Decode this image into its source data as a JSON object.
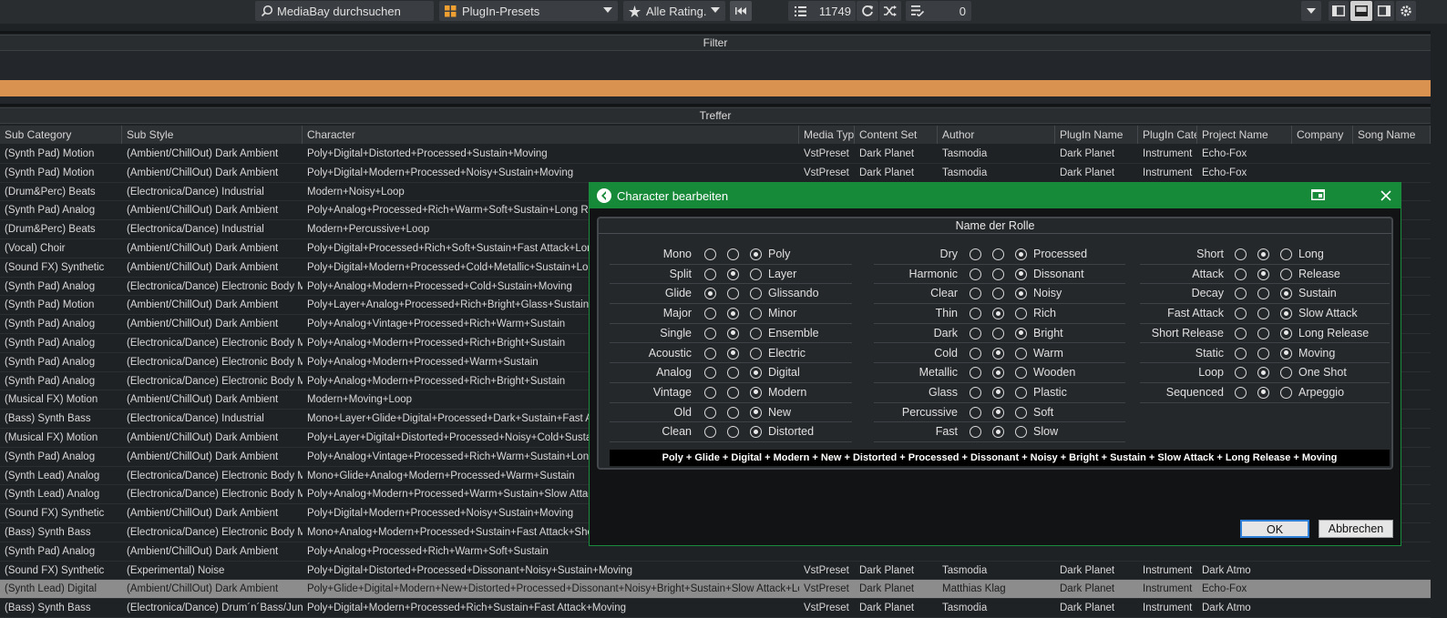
{
  "toolbar": {
    "search_placeholder": "MediaBay durchsuchen",
    "preset_select": "PlugIn-Presets",
    "rating_select": "Alle Rating.",
    "result_count": "11749",
    "selected_count": "0"
  },
  "filter": {
    "title": "Filter"
  },
  "results": {
    "title": "Treffer",
    "columns": [
      "Sub Category",
      "Sub Style",
      "Character",
      "Media Type",
      "Content Set",
      "Author",
      "PlugIn Name",
      "PlugIn Cate",
      "Project Name",
      "Company",
      "Song Name"
    ],
    "rows": [
      [
        "(Synth Pad) Motion",
        "(Ambient/ChillOut) Dark Ambient",
        "Poly+Digital+Distorted+Processed+Sustain+Moving",
        "VstPreset",
        "Dark Planet",
        "Tasmodia",
        "Dark Planet",
        "Instrument",
        "Echo-Fox",
        "",
        ""
      ],
      [
        "(Synth Pad) Motion",
        "(Ambient/ChillOut) Dark Ambient",
        "Poly+Digital+Modern+Processed+Noisy+Sustain+Moving",
        "VstPreset",
        "Dark Planet",
        "Tasmodia",
        "Dark Planet",
        "Instrument",
        "Echo-Fox",
        "",
        ""
      ],
      [
        "(Drum&Perc) Beats",
        "(Electronica/Dance) Industrial",
        "Modern+Noisy+Loop",
        "",
        "",
        "",
        "",
        "",
        "",
        "",
        ""
      ],
      [
        "(Synth Pad) Analog",
        "(Ambient/ChillOut) Dark Ambient",
        "Poly+Analog+Processed+Rich+Warm+Soft+Sustain+Long Releas",
        "",
        "",
        "",
        "",
        "",
        "",
        "",
        ""
      ],
      [
        "(Drum&Perc) Beats",
        "(Electronica/Dance) Industrial",
        "Modern+Percussive+Loop",
        "",
        "",
        "",
        "",
        "",
        "",
        "",
        ""
      ],
      [
        "(Vocal) Choir",
        "(Ambient/ChillOut) Dark Ambient",
        "Poly+Digital+Processed+Rich+Soft+Sustain+Fast Attack+Long R",
        "",
        "",
        "",
        "",
        "",
        "",
        "",
        ""
      ],
      [
        "(Sound FX) Synthetic",
        "(Ambient/ChillOut) Dark Ambient",
        "Poly+Digital+Modern+Processed+Cold+Metallic+Sustain+Long",
        "",
        "",
        "",
        "",
        "",
        "",
        "",
        ""
      ],
      [
        "(Synth Pad) Analog",
        "(Electronica/Dance) Electronic Body Musi",
        "Poly+Analog+Modern+Processed+Cold+Sustain+Moving",
        "",
        "",
        "",
        "",
        "",
        "",
        "",
        ""
      ],
      [
        "(Synth Pad) Motion",
        "(Ambient/ChillOut) Dark Ambient",
        "Poly+Layer+Analog+Processed+Rich+Bright+Glass+Sustain+Mo",
        "",
        "",
        "",
        "",
        "",
        "",
        "",
        ""
      ],
      [
        "(Synth Pad) Analog",
        "(Ambient/ChillOut) Dark Ambient",
        "Poly+Analog+Vintage+Processed+Rich+Warm+Sustain",
        "",
        "",
        "",
        "",
        "",
        "",
        "",
        ""
      ],
      [
        "(Synth Pad) Analog",
        "(Electronica/Dance) Electronic Body Musi",
        "Poly+Analog+Modern+Processed+Rich+Bright+Sustain",
        "",
        "",
        "",
        "",
        "",
        "",
        "",
        ""
      ],
      [
        "(Synth Pad) Analog",
        "(Electronica/Dance) Electronic Body Musi",
        "Poly+Analog+Modern+Processed+Warm+Sustain",
        "",
        "",
        "",
        "",
        "",
        "",
        "",
        ""
      ],
      [
        "(Synth Pad) Analog",
        "(Electronica/Dance) Electronic Body Musi",
        "Poly+Analog+Modern+Processed+Rich+Bright+Sustain",
        "",
        "",
        "",
        "",
        "",
        "",
        "",
        ""
      ],
      [
        "(Musical FX) Motion",
        "(Ambient/ChillOut) Dark Ambient",
        "Modern+Moving+Loop",
        "",
        "",
        "",
        "",
        "",
        "",
        "",
        ""
      ],
      [
        "(Bass) Synth Bass",
        "(Electronica/Dance) Industrial",
        "Mono+Layer+Glide+Digital+Processed+Dark+Sustain+Fast Attac",
        "",
        "",
        "",
        "",
        "",
        "",
        "",
        ""
      ],
      [
        "(Musical FX) Motion",
        "(Ambient/ChillOut) Dark Ambient",
        "Poly+Layer+Digital+Distorted+Processed+Noisy+Cold+Sustain+",
        "",
        "",
        "",
        "",
        "",
        "",
        "",
        ""
      ],
      [
        "(Synth Pad) Analog",
        "(Ambient/ChillOut) Dark Ambient",
        "Poly+Analog+Vintage+Processed+Rich+Warm+Sustain+Long Re",
        "",
        "",
        "",
        "",
        "",
        "",
        "",
        ""
      ],
      [
        "(Synth Lead) Analog",
        "(Electronica/Dance) Electronic Body Musi",
        "Mono+Glide+Analog+Modern+Processed+Warm+Sustain",
        "",
        "",
        "",
        "",
        "",
        "",
        "",
        ""
      ],
      [
        "(Synth Lead) Analog",
        "(Electronica/Dance) Electronic Body Musi",
        "Poly+Analog+Modern+Processed+Warm+Sustain+Slow Attack",
        "",
        "",
        "",
        "",
        "",
        "",
        "",
        ""
      ],
      [
        "(Sound FX) Synthetic",
        "(Ambient/ChillOut) Dark Ambient",
        "Poly+Digital+Modern+Processed+Noisy+Sustain+Moving",
        "",
        "",
        "",
        "",
        "",
        "",
        "",
        ""
      ],
      [
        "(Bass) Synth Bass",
        "(Electronica/Dance) Electronic Body Musi",
        "Mono+Analog+Modern+Processed+Sustain+Fast Attack+Short I",
        "",
        "",
        "",
        "",
        "",
        "",
        "",
        ""
      ],
      [
        "(Synth Pad) Analog",
        "(Ambient/ChillOut) Dark Ambient",
        "Poly+Analog+Processed+Rich+Warm+Soft+Sustain",
        "",
        "",
        "",
        "",
        "",
        "",
        "",
        ""
      ],
      [
        "(Sound FX) Synthetic",
        "(Experimental) Noise",
        "Poly+Digital+Distorted+Processed+Dissonant+Noisy+Sustain+Moving",
        "VstPreset",
        "Dark Planet",
        "Tasmodia",
        "Dark Planet",
        "Instrument",
        "Dark Atmo",
        "",
        ""
      ],
      [
        "(Synth Lead) Digital",
        "(Ambient/ChillOut) Dark Ambient",
        "Poly+Glide+Digital+Modern+New+Distorted+Processed+Dissonant+Noisy+Bright+Sustain+Slow Attack+Long R",
        "VstPreset",
        "Dark Planet",
        "Matthias Klag",
        "Dark Planet",
        "Instrument",
        "Echo-Fox",
        "",
        ""
      ],
      [
        "(Bass) Synth Bass",
        "(Electronica/Dance) Drum´n´Bass/Jungle",
        "Poly+Digital+Modern+Processed+Rich+Sustain+Fast Attack+Moving",
        "VstPreset",
        "Dark Planet",
        "Tasmodia",
        "Dark Planet",
        "Instrument",
        "Dark Atmo",
        "",
        ""
      ]
    ],
    "selected_row": 23
  },
  "dialog": {
    "title": "Character bearbeiten",
    "section_title": "Name der Rolle",
    "groups": [
      [
        {
          "left": "Mono",
          "right": "Poly",
          "sel": 2
        },
        {
          "left": "Split",
          "right": "Layer",
          "sel": 1
        },
        {
          "left": "Glide",
          "right": "Glissando",
          "sel": 0
        },
        {
          "left": "Major",
          "right": "Minor",
          "sel": 1
        },
        {
          "left": "Single",
          "right": "Ensemble",
          "sel": 1
        },
        {
          "left": "Acoustic",
          "right": "Electric",
          "sel": 1
        },
        {
          "left": "Analog",
          "right": "Digital",
          "sel": 2
        },
        {
          "left": "Vintage",
          "right": "Modern",
          "sel": 2
        },
        {
          "left": "Old",
          "right": "New",
          "sel": 2
        },
        {
          "left": "Clean",
          "right": "Distorted",
          "sel": 2
        }
      ],
      [
        {
          "left": "Dry",
          "right": "Processed",
          "sel": 2
        },
        {
          "left": "Harmonic",
          "right": "Dissonant",
          "sel": 2
        },
        {
          "left": "Clear",
          "right": "Noisy",
          "sel": 2
        },
        {
          "left": "Thin",
          "right": "Rich",
          "sel": 1
        },
        {
          "left": "Dark",
          "right": "Bright",
          "sel": 2
        },
        {
          "left": "Cold",
          "right": "Warm",
          "sel": 1
        },
        {
          "left": "Metallic",
          "right": "Wooden",
          "sel": 1
        },
        {
          "left": "Glass",
          "right": "Plastic",
          "sel": 1
        },
        {
          "left": "Percussive",
          "right": "Soft",
          "sel": 1
        },
        {
          "left": "Fast",
          "right": "Slow",
          "sel": 1
        }
      ],
      [
        {
          "left": "Short",
          "right": "Long",
          "sel": 1
        },
        {
          "left": "Attack",
          "right": "Release",
          "sel": 1
        },
        {
          "left": "Decay",
          "right": "Sustain",
          "sel": 2
        },
        {
          "left": "Fast Attack",
          "right": "Slow Attack",
          "sel": 2
        },
        {
          "left": "Short Release",
          "right": "Long Release",
          "sel": 2
        },
        {
          "left": "Static",
          "right": "Moving",
          "sel": 2
        },
        {
          "left": "Loop",
          "right": "One Shot",
          "sel": 1
        },
        {
          "left": "Sequenced",
          "right": "Arpeggio",
          "sel": 1
        }
      ]
    ],
    "summary": "Poly + Glide + Digital + Modern + New + Distorted + Processed + Dissonant + Noisy + Bright + Sustain + Slow Attack + Long Release + Moving",
    "ok_label": "OK",
    "cancel_label": "Abbrechen"
  },
  "colors": {
    "accent": "#178a3a",
    "filter_bar": "#d9924f",
    "selected_row": "#8c8c8c"
  }
}
